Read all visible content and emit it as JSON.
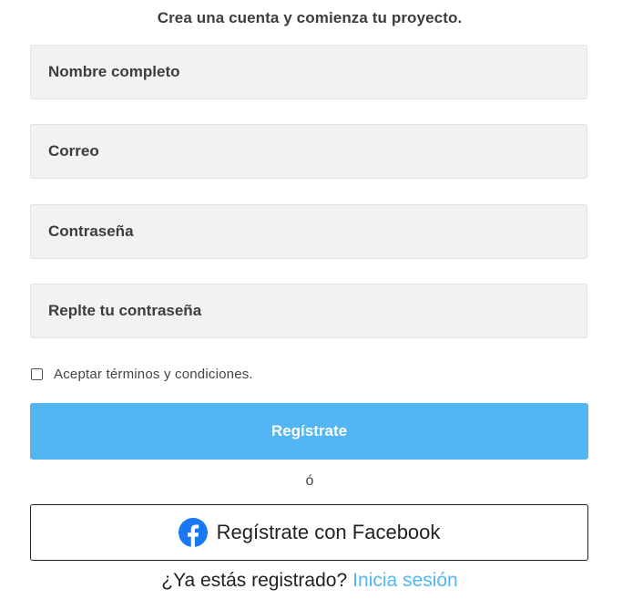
{
  "form": {
    "heading": "Crea una cuenta y comienza tu proyecto.",
    "name_placeholder": "Nombre completo",
    "email_placeholder": "Correo",
    "password_placeholder": "Contraseña",
    "repeat_password_placeholder": "Replte tu contraseña",
    "terms_label": "Aceptar términos y condiciones.",
    "terms_checked": false,
    "register_button": "Regístrate",
    "or_separator": "ó",
    "facebook_button": "Regístrate con Facebook",
    "facebook_icon": "facebook-icon",
    "login_prompt": "¿Ya estás registrado?",
    "login_link": "Inicia sesión"
  },
  "colors": {
    "accent": "#51b6f2",
    "facebook": "#1877f2",
    "field_background": "#f2f2f2"
  }
}
